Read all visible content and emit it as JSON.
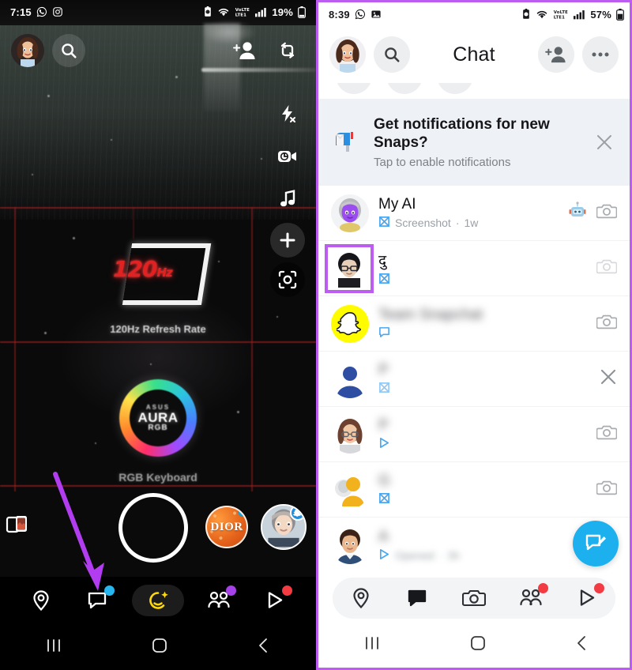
{
  "left_phone": {
    "status_bar": {
      "time": "7:15",
      "icons": [
        "whatsapp-icon",
        "instagram-icon"
      ],
      "right_icons": [
        "alarm-icon",
        "wifi-icon",
        "volte-icon",
        "signal-icon"
      ],
      "battery_percent": "19%"
    },
    "camera": {
      "top_controls": [
        {
          "name": "profile-avatar-button",
          "label": "Profile"
        },
        {
          "name": "search-icon",
          "label": "Search"
        },
        {
          "name": "add-friend-icon",
          "label": "Add Friend"
        },
        {
          "name": "flip-camera-icon",
          "label": "Flip Camera"
        }
      ],
      "right_rail": [
        {
          "name": "flash-off-icon",
          "label": "Flash Off"
        },
        {
          "name": "video-timer-icon",
          "label": "Timer"
        },
        {
          "name": "music-icon",
          "label": "Music"
        },
        {
          "name": "add-lens-icon",
          "label": "Add"
        },
        {
          "name": "scan-icon",
          "label": "Scan"
        }
      ],
      "viewfinder": {
        "hz_value": "120",
        "hz_unit": "Hz",
        "hz_caption": "120Hz Refresh Rate",
        "aura_brand": "ASUS",
        "aura_title": "AURA",
        "aura_sub": "RGB",
        "keyboard_caption": "RGB Keyboard"
      },
      "bottom_controls": [
        {
          "name": "memories-icon",
          "label": "Memories"
        },
        {
          "name": "shutter-button",
          "label": "Capture"
        },
        {
          "name": "lens-dior",
          "label": "DIOR"
        },
        {
          "name": "lens-avatar",
          "label": "Lens"
        }
      ]
    },
    "bottom_nav": [
      {
        "name": "nav-map",
        "label": "Map",
        "badge": "none",
        "active": false
      },
      {
        "name": "nav-chat",
        "label": "Chat",
        "badge": "blue",
        "active": false
      },
      {
        "name": "nav-camera",
        "label": "Camera",
        "badge": "none",
        "active": true
      },
      {
        "name": "nav-friends",
        "label": "Friends",
        "badge": "purple",
        "active": false
      },
      {
        "name": "nav-spotlight",
        "label": "Spotlight",
        "badge": "red",
        "active": false
      }
    ],
    "android_nav": [
      {
        "name": "recents-button",
        "label": "Recents"
      },
      {
        "name": "home-button",
        "label": "Home"
      },
      {
        "name": "back-button",
        "label": "Back"
      }
    ],
    "annotation": {
      "name": "purple-arrow",
      "points_to": "nav-chat"
    }
  },
  "right_phone": {
    "status_bar": {
      "time": "8:39",
      "icons": [
        "whatsapp-icon",
        "gallery-icon"
      ],
      "right_icons": [
        "alarm-icon",
        "wifi-icon",
        "volte-icon",
        "signal-icon"
      ],
      "battery_percent": "57%"
    },
    "header": {
      "title": "Chat",
      "avatar_label": "Profile",
      "search_label": "Search",
      "add_friend_label": "Add Friend",
      "more_label": "More Options"
    },
    "notification_banner": {
      "emoji": "mailbox-icon",
      "title": "Get notifications for new Snaps?",
      "subtitle": "Tap to enable notifications",
      "close_label": "Dismiss"
    },
    "chats": [
      {
        "name": "My AI",
        "name_blurred": false,
        "status_icon": "snap-received-icon",
        "status_text": "Screenshot",
        "time": "1w",
        "avatar": "my-ai-bitmoji",
        "trailing": [
          "robot-emoji",
          "camera-icon"
        ],
        "highlighted": false
      },
      {
        "name": "दु",
        "name_blurred": true,
        "status_icon": "snap-received-icon",
        "status_text": "",
        "time": "",
        "avatar": "bitmoji-glasses",
        "trailing": [
          "camera-icon"
        ],
        "highlighted": true
      },
      {
        "name": "Team Snapchat",
        "name_blurred": true,
        "status_icon": "chat-icon",
        "status_text": "",
        "time": "",
        "avatar": "snapchat-ghost",
        "trailing": [
          "camera-icon"
        ],
        "highlighted": false
      },
      {
        "name": "P",
        "name_blurred": true,
        "status_icon": "snap-sent-icon",
        "status_text": "",
        "time": "",
        "avatar": "default-person",
        "trailing": [
          "close-icon"
        ],
        "highlighted": false
      },
      {
        "name": "P",
        "name_blurred": true,
        "status_icon": "snap-delivered-icon",
        "status_text": "",
        "time": "",
        "avatar": "bitmoji-woman",
        "trailing": [
          "camera-icon"
        ],
        "highlighted": false
      },
      {
        "name": "G",
        "name_blurred": true,
        "status_icon": "snap-received-icon",
        "status_text": "",
        "time": "",
        "avatar": "group-avatar",
        "trailing": [
          "camera-icon"
        ],
        "highlighted": false
      },
      {
        "name": "A",
        "name_blurred": true,
        "status_icon": "snap-opened-icon",
        "status_text": "Opened",
        "time": "3h",
        "avatar": "bitmoji-man",
        "trailing": [],
        "highlighted": false
      }
    ],
    "compose_button": {
      "name": "new-chat-button",
      "label": "New Chat"
    },
    "bottom_nav": [
      {
        "name": "nav-map",
        "label": "Map",
        "badge": "none",
        "active": false
      },
      {
        "name": "nav-chat",
        "label": "Chat",
        "badge": "none",
        "active": true
      },
      {
        "name": "nav-camera",
        "label": "Camera",
        "badge": "none",
        "active": false
      },
      {
        "name": "nav-friends",
        "label": "Friends",
        "badge": "red",
        "active": false
      },
      {
        "name": "nav-spotlight",
        "label": "Spotlight",
        "badge": "red",
        "active": false
      }
    ],
    "android_nav": [
      {
        "name": "recents-button",
        "label": "Recents"
      },
      {
        "name": "home-button",
        "label": "Home"
      },
      {
        "name": "back-button",
        "label": "Back"
      }
    ]
  },
  "colors": {
    "accent_purple": "#bd5cf0",
    "snap_yellow": "#FFFC00",
    "badge_blue": "#26b7f0",
    "badge_red": "#f23b43",
    "fab_blue": "#1cb0ef"
  }
}
